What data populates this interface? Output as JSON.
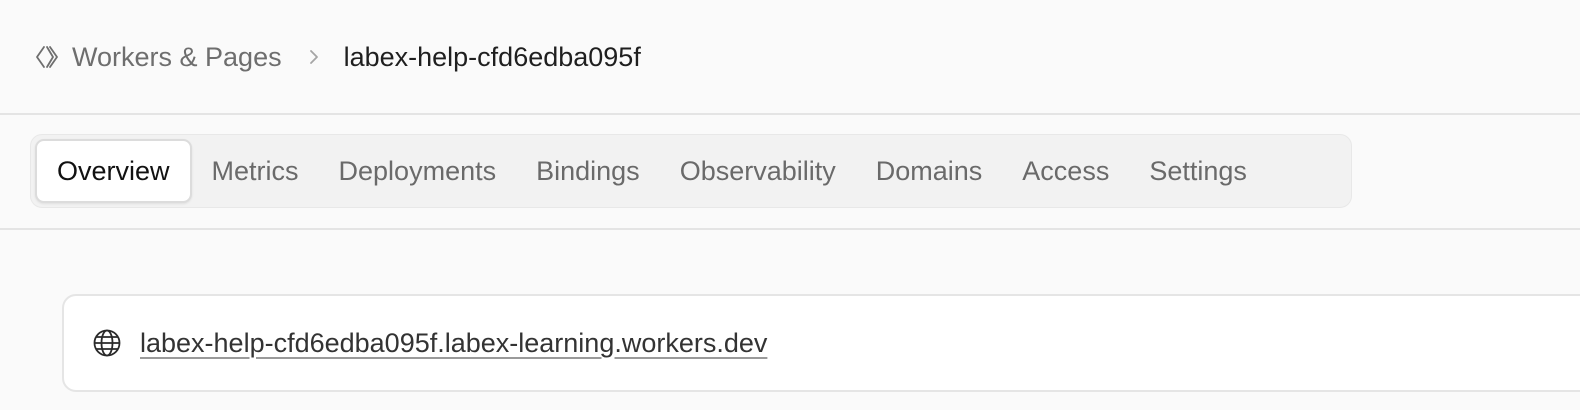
{
  "breadcrumb": {
    "parent_icon": "workers-pages-icon",
    "parent_label": "Workers & Pages",
    "separator_icon": "chevron-right-icon",
    "current_label": "labex-help-cfd6edba095f"
  },
  "tabs": [
    {
      "label": "Overview",
      "active": true
    },
    {
      "label": "Metrics",
      "active": false
    },
    {
      "label": "Deployments",
      "active": false
    },
    {
      "label": "Bindings",
      "active": false
    },
    {
      "label": "Observability",
      "active": false
    },
    {
      "label": "Domains",
      "active": false
    },
    {
      "label": "Access",
      "active": false
    },
    {
      "label": "Settings",
      "active": false
    }
  ],
  "route": {
    "icon": "globe-icon",
    "url": "labex-help-cfd6edba095f.labex-learning.workers.dev"
  }
}
